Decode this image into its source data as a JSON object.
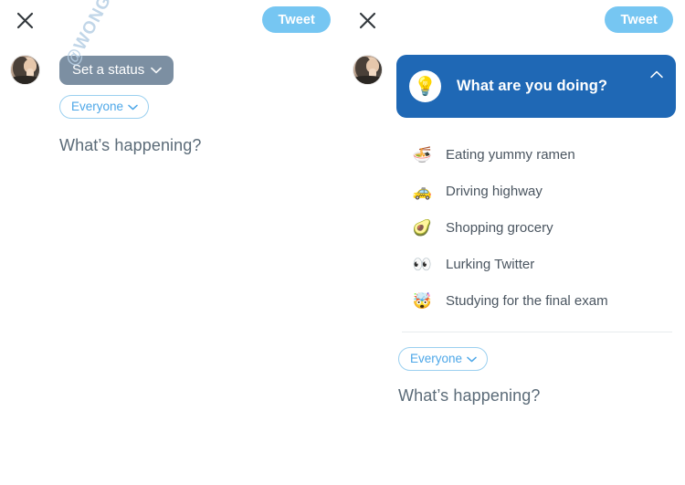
{
  "watermark": "@WONGMJANE",
  "left_screen": {
    "topbar": {
      "close_icon": "close-icon",
      "tweet_label": "Tweet"
    },
    "avatar_name": "user-avatar",
    "status_button": {
      "label": "Set a status",
      "chevron": "chevron-down-icon"
    },
    "audience_pill": {
      "label": "Everyone",
      "chevron": "chevron-down-icon"
    },
    "composer_placeholder": "What’s happening?"
  },
  "right_screen": {
    "topbar": {
      "close_icon": "close-icon",
      "tweet_label": "Tweet"
    },
    "avatar_name": "user-avatar",
    "banner": {
      "emoji": "💡",
      "emoji_name": "lightbulb-icon",
      "title": "What are you doing?",
      "collapse_icon": "chevron-up-icon"
    },
    "status_options": [
      {
        "emoji": "🍜",
        "emoji_name": "ramen-icon",
        "label": "Eating yummy ramen"
      },
      {
        "emoji": "🚕",
        "emoji_name": "taxi-icon",
        "label": "Driving highway"
      },
      {
        "emoji": "🥑",
        "emoji_name": "avocado-icon",
        "label": "Shopping grocery"
      },
      {
        "emoji": "👀",
        "emoji_name": "eyes-icon",
        "label": "Lurking Twitter"
      },
      {
        "emoji": "🤯",
        "emoji_name": "exploding-head-icon",
        "label": "Studying for the final exam"
      }
    ],
    "audience_pill": {
      "label": "Everyone",
      "chevron": "chevron-down-icon"
    },
    "composer_placeholder": "What’s happening?"
  },
  "colors": {
    "tweet_button": "#76c6f2",
    "status_button": "#7c8fa2",
    "banner": "#1f68b5",
    "audience_text": "#4da7e8",
    "placeholder_text": "#5b6b78",
    "watermark": "#b7cfe4"
  }
}
